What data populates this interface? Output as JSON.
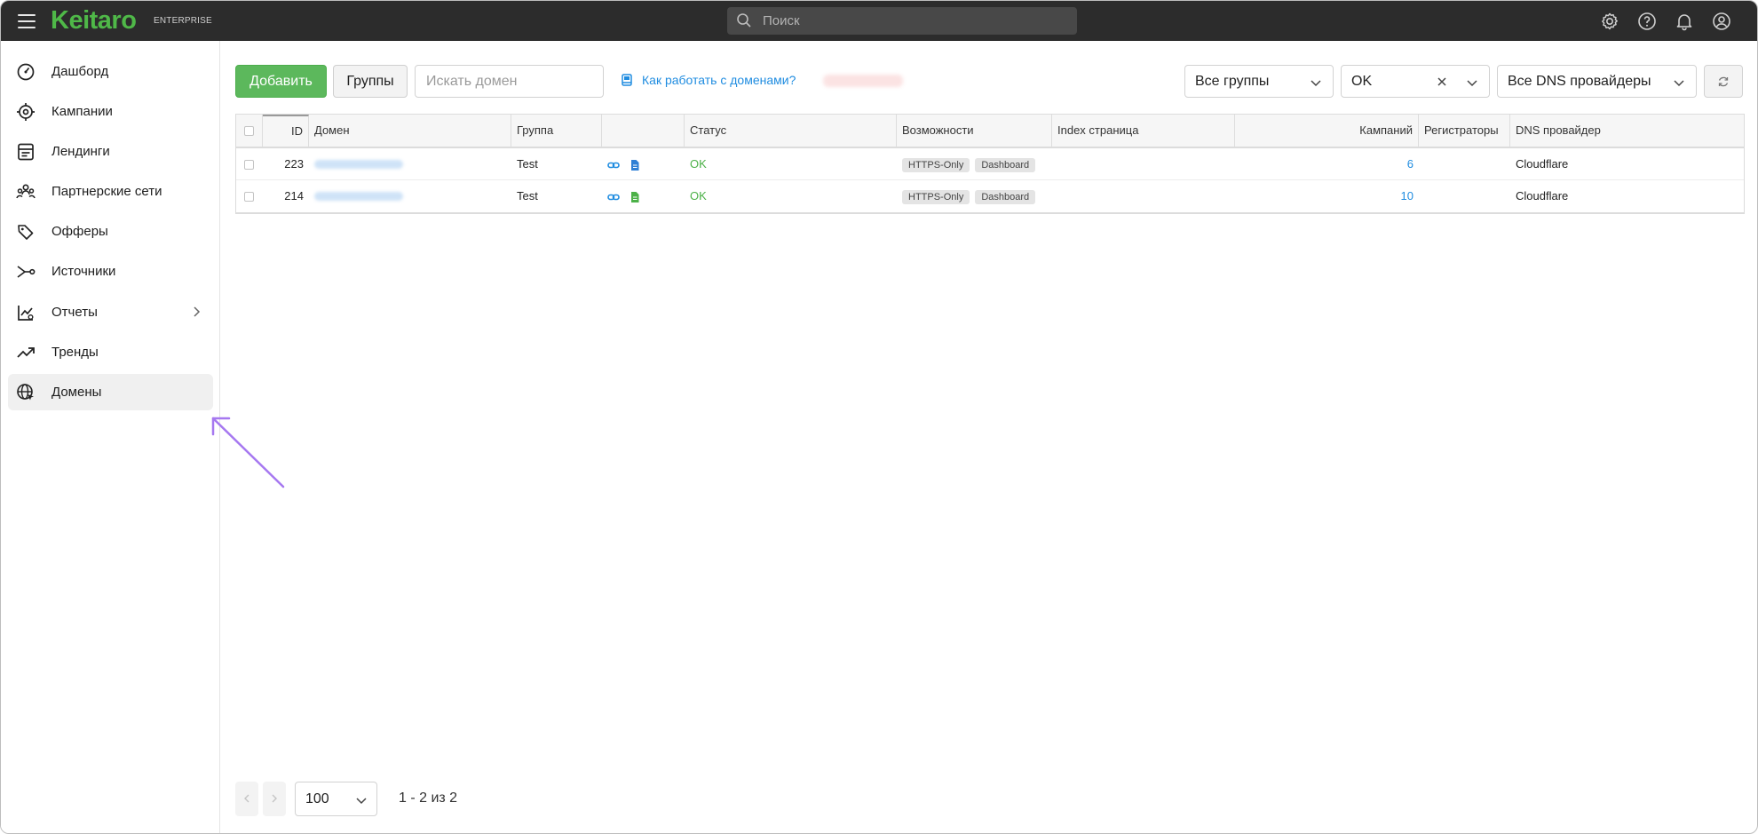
{
  "topbar": {
    "logo": "Keitaro",
    "logo_sub": "ENTERPRISE",
    "search_placeholder": "Поиск",
    "icons": [
      "settings-icon",
      "help-icon",
      "bell-icon",
      "account-icon"
    ]
  },
  "sidebar": {
    "items": [
      {
        "label": "Дашборд",
        "icon": "dashboard-icon"
      },
      {
        "label": "Кампании",
        "icon": "target-icon"
      },
      {
        "label": "Лендинги",
        "icon": "landing-icon"
      },
      {
        "label": "Партнерские сети",
        "icon": "users-icon"
      },
      {
        "label": "Офферы",
        "icon": "tags-icon"
      },
      {
        "label": "Источники",
        "icon": "source-icon"
      },
      {
        "label": "Отчеты",
        "icon": "report-icon"
      },
      {
        "label": "Тренды",
        "icon": "trend-icon"
      },
      {
        "label": "Домены",
        "icon": "globe-icon",
        "active": true
      }
    ]
  },
  "toolbar": {
    "add_label": "Добавить",
    "groups_label": "Группы",
    "search_placeholder": "Искать домен",
    "help_link": "Как работать с доменами?",
    "groups_select": "Все группы",
    "status_select": "OK",
    "dns_select": "Все DNS провайдеры"
  },
  "table": {
    "columns": [
      "ID",
      "Домен",
      "Группа",
      "",
      "Статус",
      "Возможности",
      "Index страница",
      "Кампаний",
      "Регистраторы",
      "DNS провайдер"
    ],
    "rows": [
      {
        "id": "223",
        "group": "Test",
        "status": "OK",
        "tags": [
          "HTTPS-Only",
          "Dashboard"
        ],
        "campaigns": "6",
        "dns": "Cloudflare"
      },
      {
        "id": "214",
        "group": "Test",
        "status": "OK",
        "tags": [
          "HTTPS-Only",
          "Dashboard"
        ],
        "campaigns": "10",
        "dns": "Cloudflare"
      }
    ]
  },
  "pagination": {
    "page_size": "100",
    "info": "1 - 2 из 2"
  },
  "colors": {
    "brand": "#4fb848",
    "add_button": "#5cb85c",
    "link": "#1f8ce0",
    "status_ok": "#4cb148",
    "annotation_arrow": "#a678f0"
  }
}
